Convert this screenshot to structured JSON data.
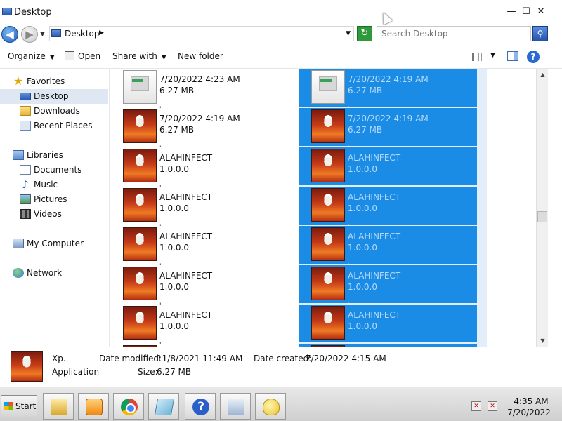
{
  "window": {
    "title": "Desktop",
    "minimize": "—",
    "maximize": "☐",
    "close": "✕"
  },
  "address": {
    "location": "Desktop",
    "search_placeholder": "Search Desktop"
  },
  "toolbar": {
    "organize": "Organize",
    "open": "Open",
    "share_with": "Share with",
    "new_folder": "New folder"
  },
  "sidebar": {
    "favorites": "Favorites",
    "desktop": "Desktop",
    "downloads": "Downloads",
    "recent_places": "Recent Places",
    "libraries": "Libraries",
    "documents": "Documents",
    "music": "Music",
    "pictures": "Pictures",
    "videos": "Videos",
    "my_computer": "My Computer",
    "network": "Network"
  },
  "files": {
    "left": [
      {
        "name": "'",
        "line1": "7/20/2022 4:23 AM",
        "line2": "6.27 MB",
        "thumb": "doc"
      },
      {
        "name": "'",
        "line1": "7/20/2022 4:19 AM",
        "line2": "6.27 MB",
        "thumb": "photo"
      },
      {
        "name": "'",
        "line1": "ALAHINFECT",
        "line2": "1.0.0.0",
        "thumb": "photo"
      },
      {
        "name": "'",
        "line1": "ALAHINFECT",
        "line2": "1.0.0.0",
        "thumb": "photo"
      },
      {
        "name": "'",
        "line1": "ALAHINFECT",
        "line2": "1.0.0.0",
        "thumb": "photo"
      },
      {
        "name": "'",
        "line1": "ALAHINFECT",
        "line2": "1.0.0.0",
        "thumb": "photo"
      },
      {
        "name": "'",
        "line1": "ALAHINFECT",
        "line2": "1.0.0.0",
        "thumb": "photo"
      },
      {
        "name": "'",
        "line1": "",
        "line2": "",
        "thumb": "photo"
      }
    ],
    "right": [
      {
        "name": "'",
        "line1": "7/20/2022 4:19 AM",
        "line2": "6.27 MB",
        "thumb": "doc"
      },
      {
        "name": "'",
        "line1": "7/20/2022 4:19 AM",
        "line2": "6.27 MB",
        "thumb": "photo"
      },
      {
        "name": "'",
        "line1": "ALAHINFECT",
        "line2": "1.0.0.0",
        "thumb": "photo"
      },
      {
        "name": "'",
        "line1": "ALAHINFECT",
        "line2": "1.0.0.0",
        "thumb": "photo"
      },
      {
        "name": "'",
        "line1": "ALAHINFECT",
        "line2": "1.0.0.0",
        "thumb": "photo"
      },
      {
        "name": "'",
        "line1": "ALAHINFECT",
        "line2": "1.0.0.0",
        "thumb": "photo"
      },
      {
        "name": "'",
        "line1": "ALAHINFECT",
        "line2": "1.0.0.0",
        "thumb": "photo"
      },
      {
        "name": "'",
        "line1": "",
        "line2": "",
        "thumb": "photo"
      }
    ]
  },
  "details": {
    "name": "Xp.",
    "type": "Application",
    "date_modified_label": "Date modified:",
    "date_modified": "11/8/2021 11:49 AM",
    "size_label": "Size:",
    "size": "6.27 MB",
    "date_created_label": "Date created:",
    "date_created": "7/20/2022 4:15 AM"
  },
  "taskbar": {
    "start": "Start",
    "time": "4:35 AM",
    "date": "7/20/2022",
    "help_glyph": "?"
  },
  "colors": {
    "selection": "#1b8ce6",
    "sidebar_selected": "#dfe7f2",
    "accent": "#2a6bd1"
  }
}
